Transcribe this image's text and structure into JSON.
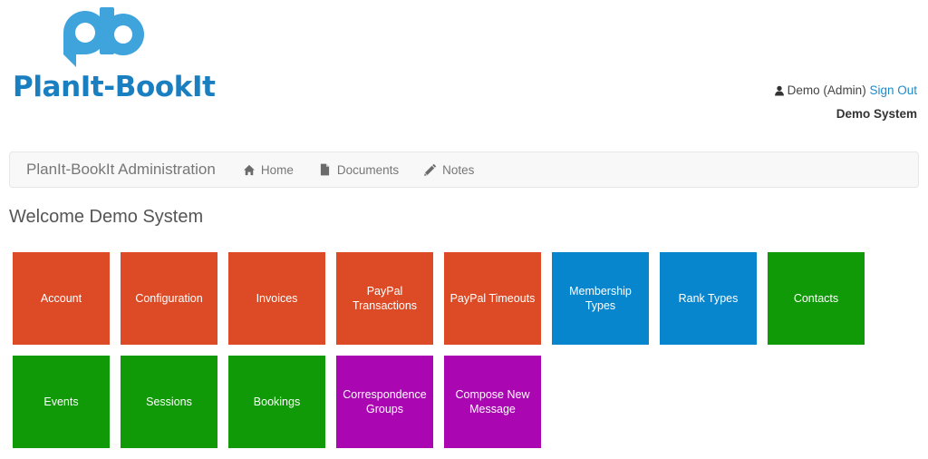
{
  "brand": {
    "logo_text": "PlanIt-BookIt",
    "logo_icon": "pb-monogram-icon",
    "logo_color": "#1A7FC1"
  },
  "userbar": {
    "user_icon": "person-icon",
    "user_label": "Demo (Admin)",
    "signout_label": "Sign Out",
    "signout_color": "#1C8ACB",
    "system_name": "Demo System"
  },
  "navbar": {
    "brand_label": "PlanIt-BookIt Administration",
    "items": [
      {
        "label": "Home",
        "icon": "home-icon"
      },
      {
        "label": "Documents",
        "icon": "document-icon"
      },
      {
        "label": "Notes",
        "icon": "pencil-icon"
      }
    ]
  },
  "main": {
    "welcome_heading": "Welcome Demo System"
  },
  "colors": {
    "orange": "#DD4B26",
    "blue": "#0786CE",
    "green": "#119A08",
    "purple": "#AA06B2"
  },
  "tiles": {
    "rows": [
      [
        {
          "label": "Account",
          "color": "#DD4B26"
        },
        {
          "label": "Configuration",
          "color": "#DD4B26"
        },
        {
          "label": "Invoices",
          "color": "#DD4B26"
        },
        {
          "label": "PayPal Transactions",
          "color": "#DD4B26"
        },
        {
          "label": "PayPal Timeouts",
          "color": "#DD4B26"
        },
        {
          "label": "Membership Types",
          "color": "#0786CE"
        },
        {
          "label": "Rank Types",
          "color": "#0786CE"
        },
        {
          "label": "Contacts",
          "color": "#119A08"
        }
      ],
      [
        {
          "label": "Events",
          "color": "#119A08"
        },
        {
          "label": "Sessions",
          "color": "#119A08"
        },
        {
          "label": "Bookings",
          "color": "#119A08"
        },
        {
          "label": "Correspondence Groups",
          "color": "#AA06B2"
        },
        {
          "label": "Compose New Message",
          "color": "#AA06B2"
        }
      ]
    ]
  }
}
